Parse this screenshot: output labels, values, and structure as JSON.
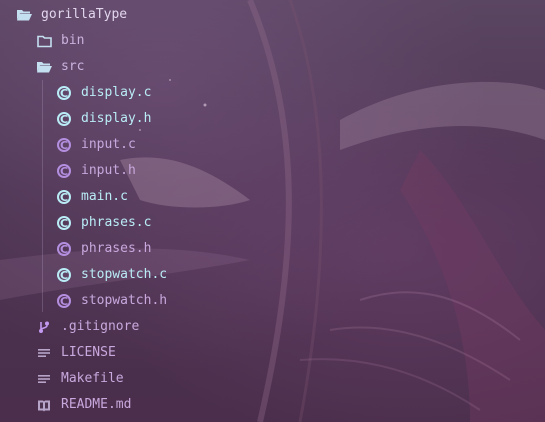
{
  "colors": {
    "folder_icon": "#c4dff0",
    "c_icon_modified": "#b9ecf6",
    "c_icon_plain": "#b48fe0",
    "text_modified": "#b9ecf6",
    "text_plain": "#c8a8dd",
    "git_icon": "#c39af0",
    "doc_icon": "#b7a4c9"
  },
  "explorer": {
    "root": {
      "label": "gorillaType",
      "icon": "folder-open-icon"
    },
    "bin": {
      "label": "bin",
      "icon": "folder-icon"
    },
    "src": {
      "label": "src",
      "icon": "folder-open-icon",
      "files": [
        {
          "label": "display.c",
          "icon": "c-file-icon",
          "modified": true
        },
        {
          "label": "display.h",
          "icon": "c-file-icon",
          "modified": true
        },
        {
          "label": "input.c",
          "icon": "c-file-icon",
          "modified": false
        },
        {
          "label": "input.h",
          "icon": "c-file-icon",
          "modified": false
        },
        {
          "label": "main.c",
          "icon": "c-file-icon",
          "modified": true
        },
        {
          "label": "phrases.c",
          "icon": "c-file-icon",
          "modified": true
        },
        {
          "label": "phrases.h",
          "icon": "c-file-icon",
          "modified": false
        },
        {
          "label": "stopwatch.c",
          "icon": "c-file-icon",
          "modified": true
        },
        {
          "label": "stopwatch.h",
          "icon": "c-file-icon",
          "modified": false
        }
      ]
    },
    "root_files": [
      {
        "label": ".gitignore",
        "icon": "git-branch-icon"
      },
      {
        "label": "LICENSE",
        "icon": "lines-icon"
      },
      {
        "label": "Makefile",
        "icon": "lines-icon"
      },
      {
        "label": "README.md",
        "icon": "book-icon"
      }
    ]
  }
}
